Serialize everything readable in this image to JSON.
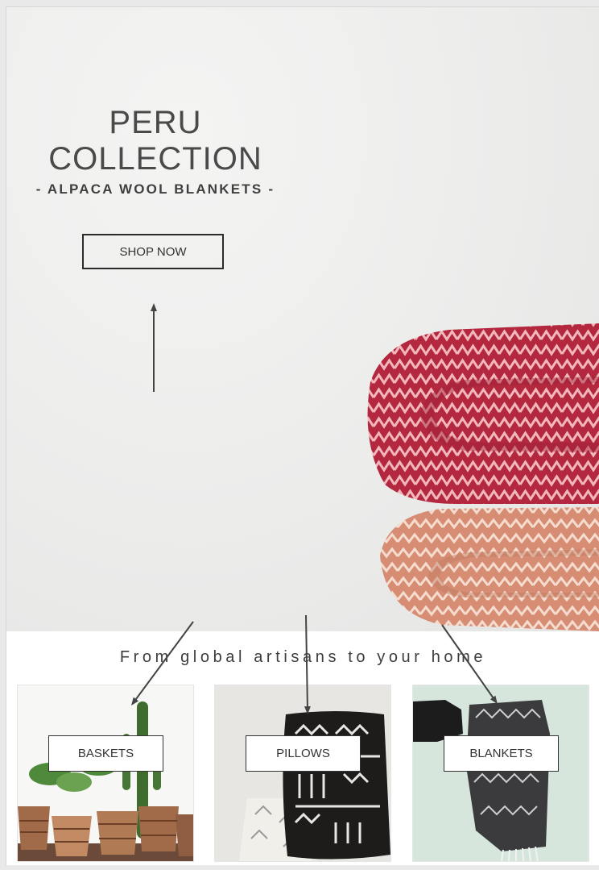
{
  "hero": {
    "title_line1": "PERU",
    "title_line2": "COLLECTION",
    "subtitle": "- ALPACA WOOL BLANKETS -",
    "button_label": "SHOP NOW"
  },
  "tagline": "From global artisans to your home",
  "categories": [
    {
      "label": "BASKETS"
    },
    {
      "label": "PILLOWS"
    },
    {
      "label": "BLANKETS"
    }
  ],
  "colors": {
    "text": "#4a4a4a",
    "blanket_red": "#b0283d",
    "blanket_peach": "#d8957c",
    "arrow": "#444444"
  }
}
